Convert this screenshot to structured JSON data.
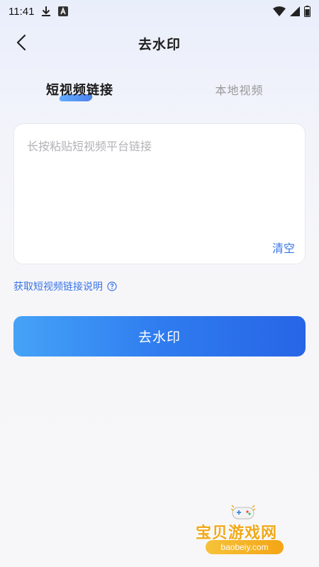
{
  "status_bar": {
    "time": "11:41"
  },
  "nav": {
    "title": "去水印"
  },
  "tabs": [
    {
      "label": "短视频链接",
      "active": true
    },
    {
      "label": "本地视频",
      "active": false
    }
  ],
  "link_input": {
    "placeholder": "长按粘贴短视频平台链接",
    "value": ""
  },
  "clear_label": "清空",
  "help_link": "获取短视频链接说明",
  "primary_button": "去水印",
  "watermark": {
    "name": "宝贝游戏网",
    "domain": "baobeiy.com"
  },
  "colors": {
    "accent": "#3a74e6",
    "button_gradient_start": "#45a3f7",
    "button_gradient_end": "#2765e6",
    "watermark": "#f0a91a"
  }
}
